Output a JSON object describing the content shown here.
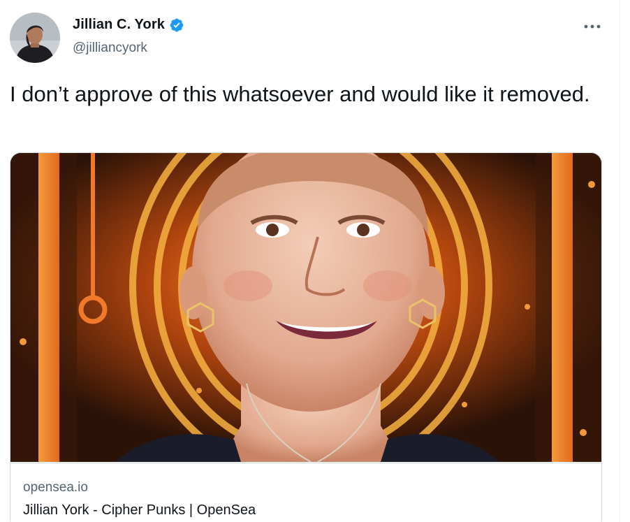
{
  "author": {
    "display_name": "Jillian C. York",
    "handle": "@jilliancyork",
    "verified": true,
    "verified_icon": "verified-badge-icon",
    "avatar_icon": "avatar-photo"
  },
  "tweet": {
    "text": "I don’t approve of this whatsoever and would like it removed."
  },
  "actions": {
    "more_label": "•••",
    "more_icon": "more-options-icon"
  },
  "card": {
    "domain": "opensea.io",
    "title": "Jillian York - Cipher Punks | OpenSea",
    "image_icon": "nft-portrait-illustration"
  },
  "colors": {
    "verified_blue": "#1d9bf0",
    "text_primary": "#0f1419",
    "text_secondary": "#536471",
    "border": "#cfd9de",
    "art_orange": "#f07a2a",
    "art_dark": "#2a1207"
  }
}
